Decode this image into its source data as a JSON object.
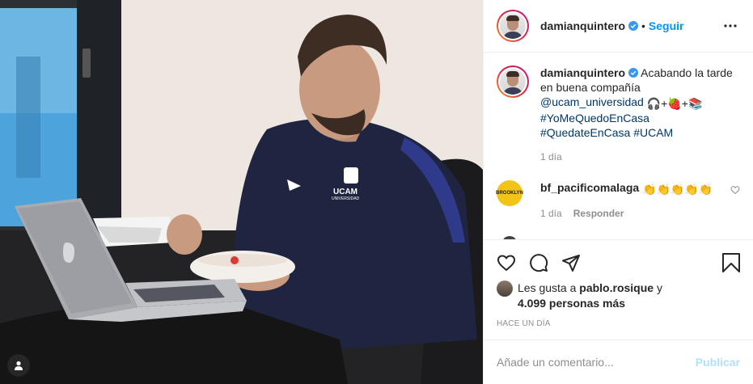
{
  "post": {
    "author": "damianquintero",
    "follow_label": "Seguir",
    "separator": "•"
  },
  "caption": {
    "user": "damianquintero",
    "text_1": "Acabando la tarde en buena compañía",
    "mention": "@ucam_universidad",
    "emoji_sequence": "🎧+🍓+📚",
    "hashtags": [
      "#YoMeQuedoEnCasa",
      "#QuedateEnCasa",
      "#UCAM"
    ],
    "age": "1 día"
  },
  "comments": [
    {
      "user": "bf_pacificomalaga",
      "avatar_text": "BROOKLYN",
      "text": "👏👏👏👏👏",
      "age": "1 día",
      "reply_label": "Responder"
    }
  ],
  "likes": {
    "prefix": "Les gusta a",
    "user": "pablo.rosique",
    "joiner": "y",
    "others": "4.099 personas más"
  },
  "timestamp": "Hace un día",
  "composer": {
    "placeholder": "Añade un comentario...",
    "publish_label": "Publicar"
  },
  "colors": {
    "accent": "#0095f6",
    "publish_disabled": "#b2dffc",
    "link": "#00376b",
    "muted": "#8e8e8e",
    "brand_badge": "#f3c418"
  },
  "photo": {
    "shirt_text": "UCAM",
    "shirt_subtext": "UNIVERSIDAD"
  }
}
